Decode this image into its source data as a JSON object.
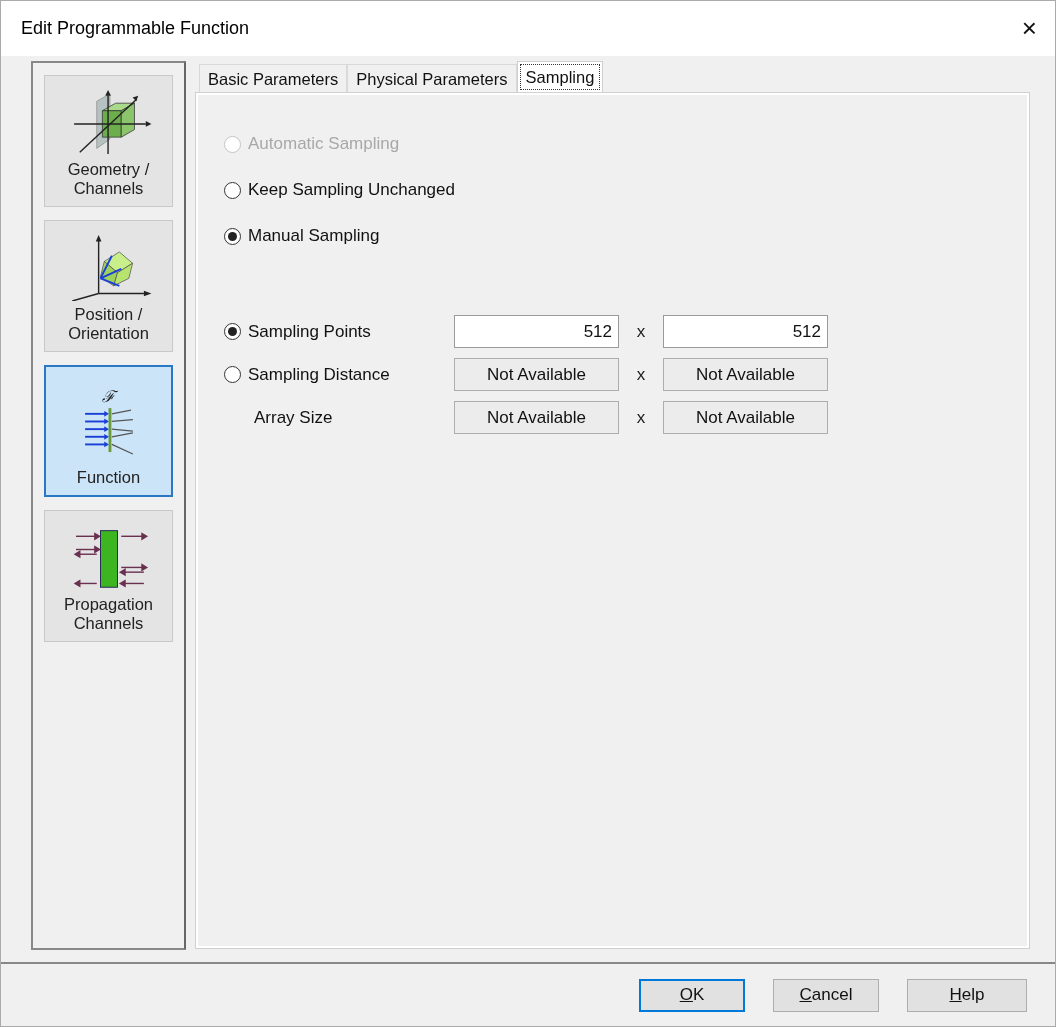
{
  "window": {
    "title": "Edit Programmable Function",
    "close": "×"
  },
  "sidebar": {
    "items": [
      {
        "kind": "geometry",
        "label": "Geometry / Channels",
        "selected": false
      },
      {
        "kind": "position",
        "label": "Position / Orientation",
        "selected": false
      },
      {
        "kind": "function",
        "label": "Function",
        "symbol": "ℱ",
        "selected": true
      },
      {
        "kind": "propagation",
        "label": "Propagation Channels",
        "selected": false
      }
    ]
  },
  "tabs": [
    {
      "label": "Basic Parameters",
      "selected": false
    },
    {
      "label": "Physical Parameters",
      "selected": false
    },
    {
      "label": "Sampling",
      "selected": true
    }
  ],
  "mode_options": [
    {
      "label": "Automatic Sampling",
      "checked": false,
      "disabled": true
    },
    {
      "label": "Keep Sampling Unchanged",
      "checked": false,
      "disabled": false
    },
    {
      "label": "Manual Sampling",
      "checked": true,
      "disabled": false
    }
  ],
  "sampling_rows": [
    {
      "kind": "radio",
      "label": "Sampling Points",
      "checked": true,
      "fields": [
        {
          "kind": "input",
          "value": "512"
        },
        {
          "kind": "input",
          "value": "512"
        }
      ],
      "separator": "x"
    },
    {
      "kind": "radio",
      "label": "Sampling Distance",
      "checked": false,
      "fields": [
        {
          "kind": "readonly",
          "value": "Not Available"
        },
        {
          "kind": "readonly",
          "value": "Not Available"
        }
      ],
      "separator": "x"
    },
    {
      "kind": "label",
      "label": "Array Size",
      "fields": [
        {
          "kind": "readonly",
          "value": "Not Available"
        },
        {
          "kind": "readonly",
          "value": "Not Available"
        }
      ],
      "separator": "x"
    }
  ],
  "buttons": [
    {
      "label": "OK",
      "default": true,
      "mnemonic": true
    },
    {
      "label": "Cancel",
      "default": false,
      "mnemonic": true
    },
    {
      "label": "Help",
      "default": false,
      "mnemonic": true
    }
  ]
}
